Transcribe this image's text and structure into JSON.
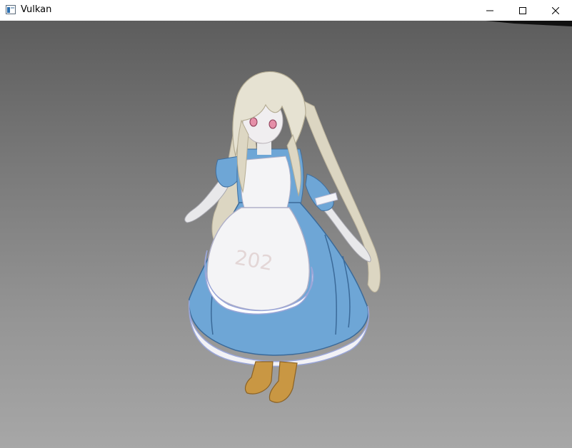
{
  "window": {
    "title": "Vulkan",
    "icons": {
      "app": "window-app-icon",
      "minimize": "minimize-icon",
      "maximize": "maximize-icon",
      "close": "close-icon"
    }
  },
  "scene": {
    "apron_text": "202",
    "colors": {
      "dress": "#6ea6d6",
      "apron": "#f2f2f4",
      "hair": "#e6e2d2",
      "boots": "#c99743",
      "background_top": "#5d5d5d",
      "background_bottom": "#a7a7a7"
    }
  }
}
